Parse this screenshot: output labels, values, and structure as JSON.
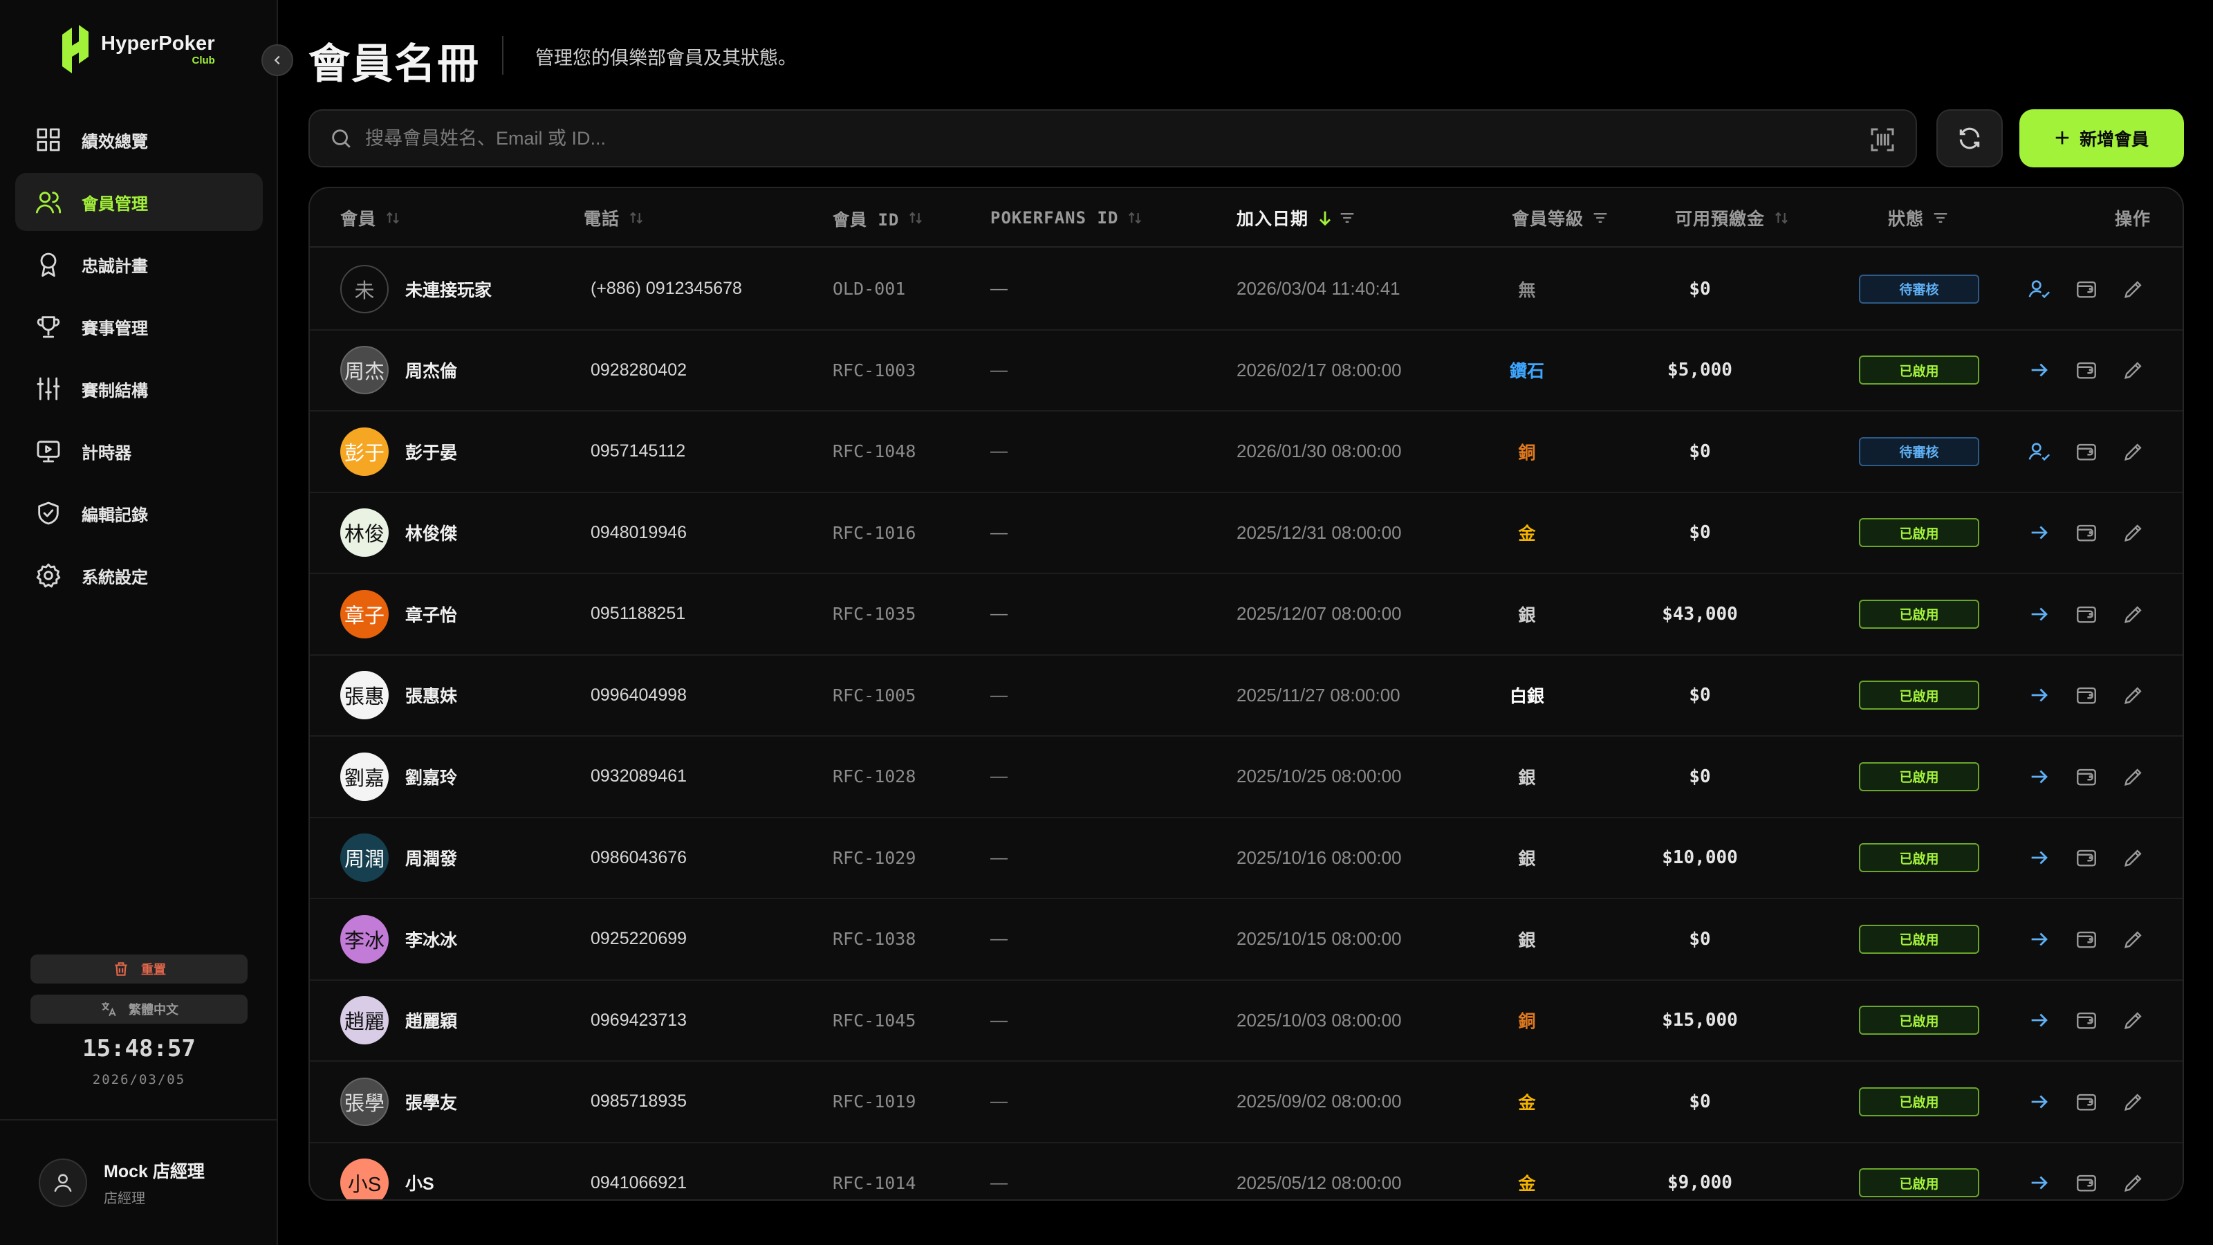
{
  "brand": {
    "name": "HyperPoker",
    "sub": "Club"
  },
  "nav": [
    {
      "label": "績效總覽",
      "icon": "dashboard-icon"
    },
    {
      "label": "會員管理",
      "icon": "members-icon",
      "active": true
    },
    {
      "label": "忠誠計畫",
      "icon": "award-icon"
    },
    {
      "label": "賽事管理",
      "icon": "trophy-icon"
    },
    {
      "label": "賽制結構",
      "icon": "sliders-icon"
    },
    {
      "label": "計時器",
      "icon": "monitor-icon"
    },
    {
      "label": "編輯記錄",
      "icon": "shield-icon"
    },
    {
      "label": "系統設定",
      "icon": "gear-icon"
    }
  ],
  "sidebar_footer": {
    "reset_label": "重置",
    "language_label": "繁體中文",
    "clock_time": "15:48:57",
    "clock_date": "2026/03/05",
    "user_name": "Mock 店經理",
    "user_role": "店經理"
  },
  "page": {
    "title": "會員名冊",
    "subtitle": "管理您的俱樂部會員及其狀態。",
    "search_placeholder": "搜尋會員姓名、Email 或 ID...",
    "add_label": "新增會員"
  },
  "columns": {
    "member": "會員",
    "phone": "電話",
    "member_id": "會員 ID",
    "pokerfans_id": "POKERFANS ID",
    "join_date": "加入日期",
    "tier": "會員等級",
    "balance": "可用預繳金",
    "status": "狀態",
    "actions": "操作"
  },
  "colors": {
    "accent": "#a3f23a",
    "pending": "#5fb0f5",
    "diamond": "#3ea6ff",
    "bronze": "#e07a1f",
    "gold": "#f5b400",
    "silver": "#d0d0d0",
    "none": "#8c8c8c"
  },
  "members": [
    {
      "avatar": "未",
      "name": "未連接玩家",
      "phone": "(+886) 0912345678",
      "member_id": "OLD-001",
      "pokerfans_id": "—",
      "join_date": "2026/03/04 11:40:41",
      "tier": "無",
      "balance": "$0",
      "status": "待審核"
    },
    {
      "avatar": "周杰",
      "name": "周杰倫",
      "phone": "0928280402",
      "member_id": "RFC-1003",
      "pokerfans_id": "—",
      "join_date": "2026/02/17 08:00:00",
      "tier": "鑽石",
      "balance": "$5,000",
      "status": "已啟用"
    },
    {
      "avatar": "彭于",
      "name": "彭于晏",
      "phone": "0957145112",
      "member_id": "RFC-1048",
      "pokerfans_id": "—",
      "join_date": "2026/01/30 08:00:00",
      "tier": "銅",
      "balance": "$0",
      "status": "待審核"
    },
    {
      "avatar": "林俊",
      "name": "林俊傑",
      "phone": "0948019946",
      "member_id": "RFC-1016",
      "pokerfans_id": "—",
      "join_date": "2025/12/31 08:00:00",
      "tier": "金",
      "balance": "$0",
      "status": "已啟用"
    },
    {
      "avatar": "章子",
      "name": "章子怡",
      "phone": "0951188251",
      "member_id": "RFC-1035",
      "pokerfans_id": "—",
      "join_date": "2025/12/07 08:00:00",
      "tier": "銀",
      "balance": "$43,000",
      "status": "已啟用"
    },
    {
      "avatar": "張惠",
      "name": "張惠妹",
      "phone": "0996404998",
      "member_id": "RFC-1005",
      "pokerfans_id": "—",
      "join_date": "2025/11/27 08:00:00",
      "tier": "白銀",
      "balance": "$0",
      "status": "已啟用"
    },
    {
      "avatar": "劉嘉",
      "name": "劉嘉玲",
      "phone": "0932089461",
      "member_id": "RFC-1028",
      "pokerfans_id": "—",
      "join_date": "2025/10/25 08:00:00",
      "tier": "銀",
      "balance": "$0",
      "status": "已啟用"
    },
    {
      "avatar": "周潤",
      "name": "周潤發",
      "phone": "0986043676",
      "member_id": "RFC-1029",
      "pokerfans_id": "—",
      "join_date": "2025/10/16 08:00:00",
      "tier": "銀",
      "balance": "$10,000",
      "status": "已啟用"
    },
    {
      "avatar": "李冰",
      "name": "李冰冰",
      "phone": "0925220699",
      "member_id": "RFC-1038",
      "pokerfans_id": "—",
      "join_date": "2025/10/15 08:00:00",
      "tier": "銀",
      "balance": "$0",
      "status": "已啟用"
    },
    {
      "avatar": "趙麗",
      "name": "趙麗穎",
      "phone": "0969423713",
      "member_id": "RFC-1045",
      "pokerfans_id": "—",
      "join_date": "2025/10/03 08:00:00",
      "tier": "銅",
      "balance": "$15,000",
      "status": "已啟用"
    },
    {
      "avatar": "張學",
      "name": "張學友",
      "phone": "0985718935",
      "member_id": "RFC-1019",
      "pokerfans_id": "—",
      "join_date": "2025/09/02 08:00:00",
      "tier": "金",
      "balance": "$0",
      "status": "已啟用"
    },
    {
      "avatar": "小S",
      "name": "小S",
      "phone": "0941066921",
      "member_id": "RFC-1014",
      "pokerfans_id": "—",
      "join_date": "2025/05/12 08:00:00",
      "tier": "金",
      "balance": "$9,000",
      "status": "已啟用"
    }
  ]
}
